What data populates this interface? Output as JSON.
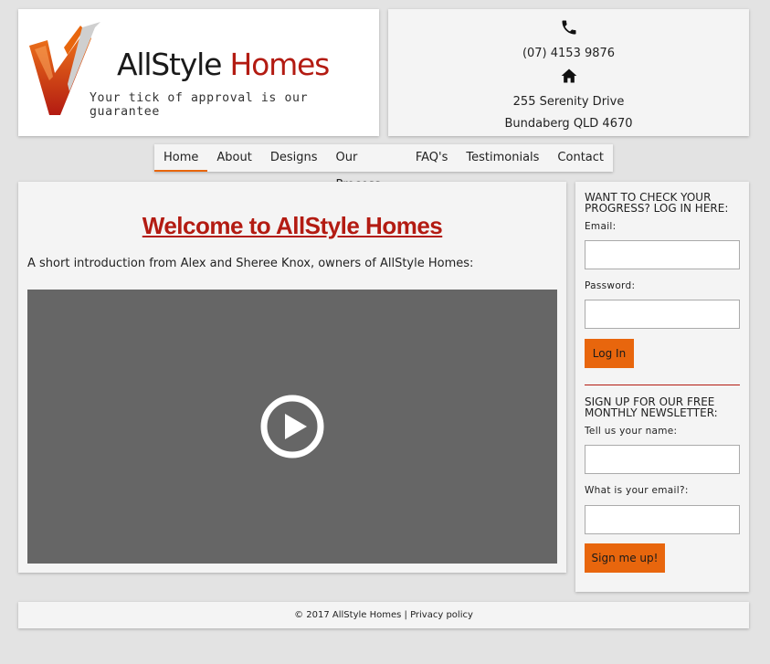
{
  "header": {
    "brand_part1": "AllStyle",
    "brand_part2": "Homes",
    "tagline": "Your tick of approval is our guarantee",
    "phone": "(07) 4153 9876",
    "address_line1": "255 Serenity Drive",
    "address_line2": "Bundaberg QLD 4670",
    "phone_icon": "phone-icon",
    "home_icon": "home-icon"
  },
  "nav": {
    "items": [
      {
        "label": "Home",
        "active": true
      },
      {
        "label": "About"
      },
      {
        "label": "Designs"
      },
      {
        "label": "Our Process"
      },
      {
        "label": "FAQ's"
      },
      {
        "label": "Testimonials"
      },
      {
        "label": "Contact"
      }
    ]
  },
  "main": {
    "title": "Welcome to AllStyle Homes",
    "intro": "A short introduction from Alex and Sheree Knox, owners of AllStyle Homes:",
    "video_icon": "play-icon"
  },
  "login": {
    "heading": "WANT TO CHECK YOUR PROGRESS? LOG IN HERE:",
    "email_label": "Email:",
    "email_value": "",
    "password_label": "Password:",
    "password_value": "",
    "button": "Log In"
  },
  "newsletter": {
    "heading": "SIGN UP FOR OUR FREE MONTHLY NEWSLETTER:",
    "name_label": "Tell us your name:",
    "name_value": "",
    "email_label": "What is your email?:",
    "email_value": "",
    "button": "Sign me up!"
  },
  "footer": {
    "copyright": "© 2017 AllStyle Homes | ",
    "privacy": "Privacy policy"
  },
  "colors": {
    "accent_orange": "#e8660d",
    "brand_red": "#b31b12",
    "background": "#e3e3e3",
    "panel": "#f4f4f4",
    "video": "#666666"
  }
}
